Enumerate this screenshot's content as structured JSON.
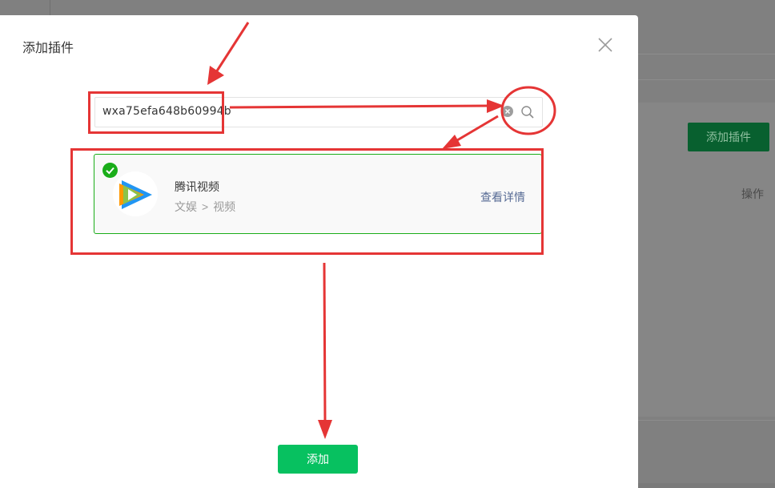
{
  "background": {
    "add_plugin_button": "添加插件",
    "operation_label": "操作"
  },
  "modal": {
    "title": "添加插件",
    "search": {
      "value": "wxa75efa648b60994b"
    },
    "result": {
      "name": "腾讯视频",
      "category_parent": "文娱",
      "category_separator": ">",
      "category_child": "视频",
      "details_link": "查看详情",
      "selected": true
    },
    "add_button": "添加"
  },
  "colors": {
    "primary_green": "#07c160",
    "card_border_green": "#1aad19",
    "link_blue": "#576b95",
    "annotation_red": "#e53535"
  },
  "icons": [
    "close-icon",
    "clear-icon",
    "search-icon",
    "check-icon",
    "tencent-video-logo"
  ]
}
